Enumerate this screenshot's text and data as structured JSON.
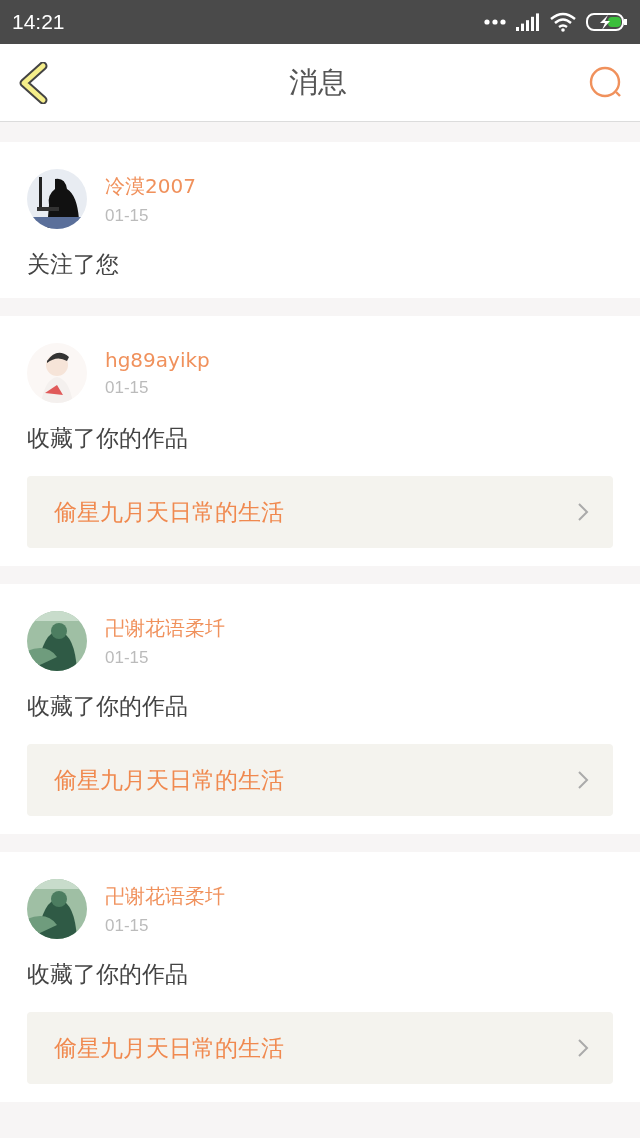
{
  "status_bar": {
    "time": "14:21"
  },
  "header": {
    "title": "消息"
  },
  "messages": [
    {
      "name": "冷漠2007",
      "date": "01-15",
      "text": "关注了您"
    },
    {
      "name": "hg89ayikp",
      "date": "01-15",
      "text": "收藏了你的作品",
      "work": "偷星九月天日常的生活"
    },
    {
      "name": "卍谢花语柔圲",
      "date": "01-15",
      "text": "收藏了你的作品",
      "work": "偷星九月天日常的生活"
    },
    {
      "name": "卍谢花语柔圲",
      "date": "01-15",
      "text": "收藏了你的作品",
      "work": "偷星九月天日常的生活"
    }
  ]
}
